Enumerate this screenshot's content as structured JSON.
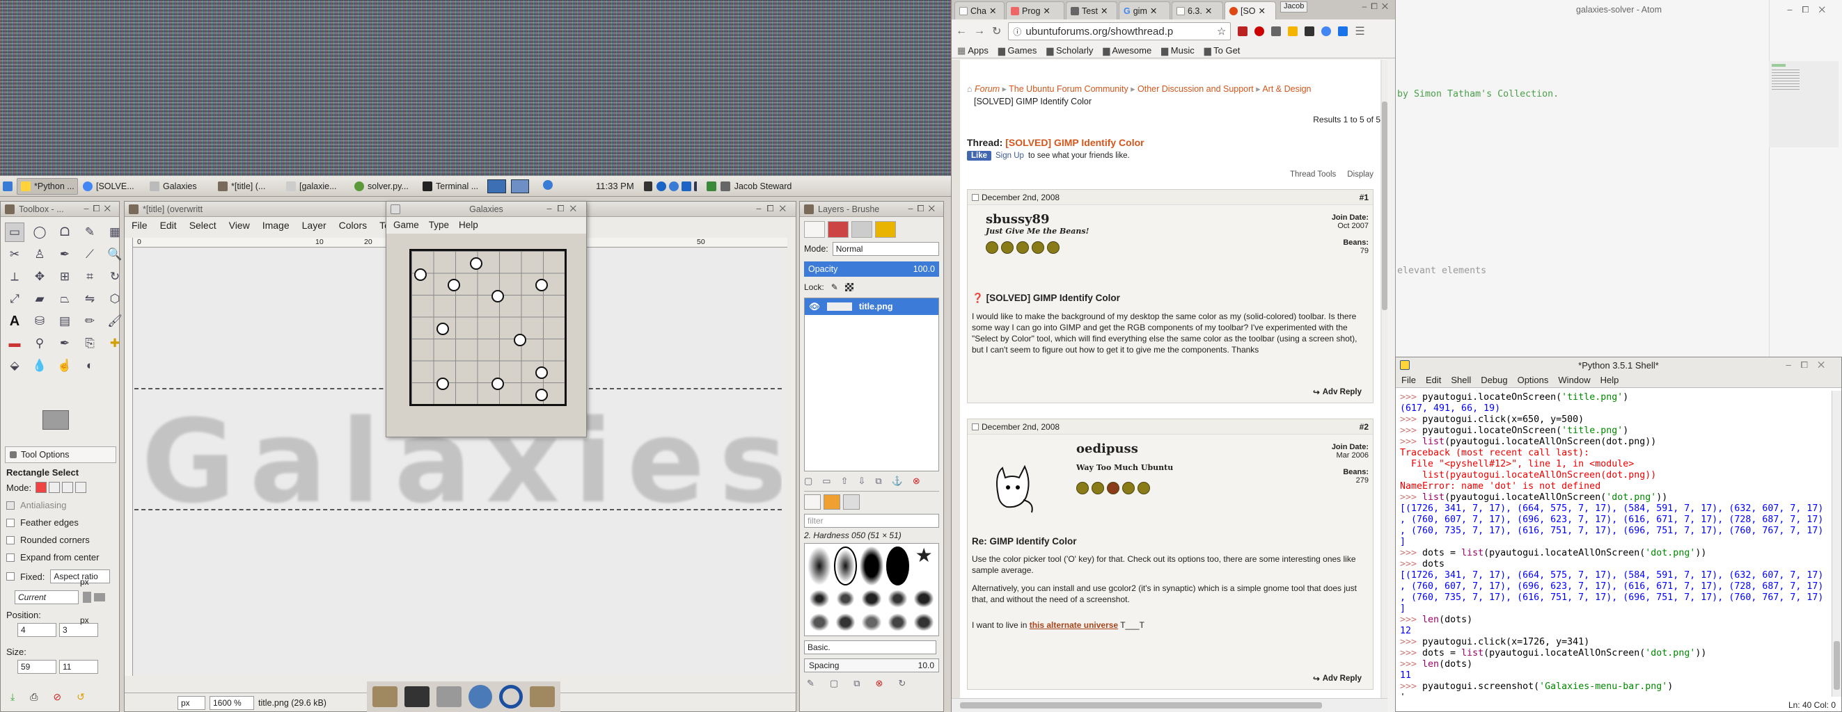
{
  "taskbar": {
    "items": [
      "*Python ...",
      "[SOLVE...",
      "Galaxies",
      "*[title] (...",
      "[galaxie...",
      "solver.py...",
      "Terminal ..."
    ],
    "time": "11:33 PM",
    "user": "Jacob Steward"
  },
  "toolbox": {
    "title": "Toolbox - ...",
    "tool_options_tab": "Tool Options",
    "tool_name": "Rectangle Select",
    "mode_label": "Mode:",
    "antialiasing": "Antialiasing",
    "feather": "Feather edges",
    "rounded": "Rounded corners",
    "expand": "Expand from center",
    "fixed": "Fixed:",
    "fixed_value": "Aspect ratio",
    "current": "Current",
    "position_label": "Position:",
    "pos_x": "4",
    "pos_y": "3",
    "pos_unit": "px",
    "size_label": "Size:",
    "size_w": "59",
    "size_h": "11",
    "size_unit": "px"
  },
  "gimp": {
    "title": "*[title] (overwritt",
    "menu": [
      "File",
      "Edit",
      "Select",
      "View",
      "Image",
      "Layer",
      "Colors",
      "Tools"
    ],
    "ruler": [
      "0",
      "10",
      "20",
      "50"
    ],
    "canvas_text": "Galaxies",
    "status_unit": "px",
    "zoom": "1600 %",
    "status_file": "title.png (29.6 kB)"
  },
  "galaxies": {
    "title": "Galaxies",
    "menu": [
      "Game",
      "Type",
      "Help"
    ]
  },
  "layers": {
    "title": "Layers - Brushe",
    "mode_label": "Mode:",
    "mode_value": "Normal",
    "opacity_label": "Opacity",
    "opacity_value": "100.0",
    "lock_label": "Lock:",
    "layer_name": "title.png",
    "filter_placeholder": "filter",
    "brush_name": "2. Hardness 050 (51 × 51)",
    "preset": "Basic.",
    "spacing_label": "Spacing",
    "spacing_value": "10.0"
  },
  "browser": {
    "tabs": [
      "Cha",
      "Prog",
      "Test",
      "gim",
      "6.3.",
      "[SO"
    ],
    "profile": "Jacob",
    "url": "ubuntuforums.org/showthread.p",
    "bookmarks": [
      "Apps",
      "Games",
      "Scholarly",
      "Awesome",
      "Music",
      "To Get"
    ],
    "breadcrumb": [
      "Forum",
      "The Ubuntu Forum Community",
      "Other Discussion and Support",
      "Art & Design"
    ],
    "thread_crumb": "[SOLVED] GIMP Identify Color",
    "results": "Results 1 to 5 of 5",
    "thread_label": "Thread:",
    "thread_title": "[SOLVED] GIMP Identify Color",
    "like": "Like",
    "signup": "Sign Up",
    "signup_rest": "to see what your friends like.",
    "thread_tools": "Thread Tools",
    "display": "Display",
    "post1": {
      "date": "December 2nd, 2008",
      "num": "#1",
      "user": "sbussy89",
      "usertitle": "Just Give Me the Beans!",
      "joined_label": "Join Date:",
      "joined": "Oct 2007",
      "beans_label": "Beans:",
      "beans": "79",
      "title": "[SOLVED] GIMP Identify Color",
      "body": "I would like to make the background of my desktop the same color as my (solid-colored) toolbar. Is there some way I can go into GIMP and get the RGB components of my toolbar? I've experimented with the \"Select by Color\" tool, which will find everything else the same color as the toolbar (using a screen shot), but I can't seem to figure out how to get it to give me the components. Thanks",
      "reply": "Adv Reply"
    },
    "post2": {
      "date": "December 2nd, 2008",
      "num": "#2",
      "user": "oedipuss",
      "usertitle": "Way Too Much Ubuntu",
      "joined_label": "Join Date:",
      "joined": "Mar 2006",
      "beans_label": "Beans:",
      "beans": "279",
      "title": "Re: GIMP Identify Color",
      "body1": "Use the color picker tool ('O' key) for that. Check out its options too, there are some interesting ones like sample average.",
      "body2": "Alternatively, you can install and use gcolor2 (it's in synaptic) which is a simple gnome tool that does just that, and without the need of a screenshot.",
      "sig_pre": "I want to live in ",
      "sig_link": "this alternate universe",
      "sig_post": " T___T",
      "reply": "Adv Reply"
    }
  },
  "atom": {
    "title": "galaxies-solver - Atom",
    "line1": "by Simon Tatham's Collection.",
    "line2": "elevant elements"
  },
  "shell": {
    "title": "*Python 3.5.1 Shell*",
    "menu": [
      "File",
      "Edit",
      "Shell",
      "Debug",
      "Options",
      "Window",
      "Help"
    ],
    "status": "Ln: 40   Col: 0"
  },
  "colors": {
    "accent": "#d4561c",
    "selection": "#3d7bd9"
  }
}
